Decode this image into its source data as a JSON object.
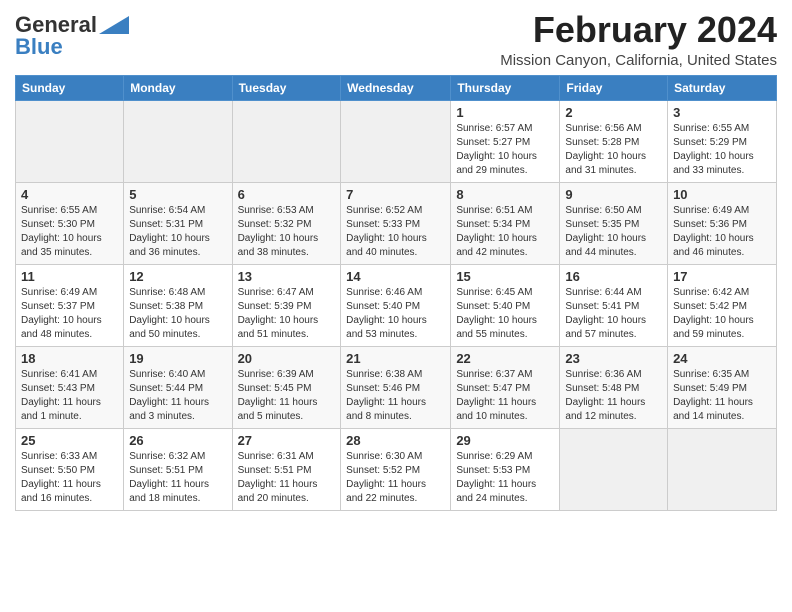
{
  "header": {
    "logo_general": "General",
    "logo_blue": "Blue",
    "month_year": "February 2024",
    "location": "Mission Canyon, California, United States"
  },
  "days_of_week": [
    "Sunday",
    "Monday",
    "Tuesday",
    "Wednesday",
    "Thursday",
    "Friday",
    "Saturday"
  ],
  "weeks": [
    [
      {
        "date": "",
        "info": "",
        "empty": true
      },
      {
        "date": "",
        "info": "",
        "empty": true
      },
      {
        "date": "",
        "info": "",
        "empty": true
      },
      {
        "date": "",
        "info": "",
        "empty": true
      },
      {
        "date": "1",
        "info": "Sunrise: 6:57 AM\nSunset: 5:27 PM\nDaylight: 10 hours\nand 29 minutes.",
        "empty": false
      },
      {
        "date": "2",
        "info": "Sunrise: 6:56 AM\nSunset: 5:28 PM\nDaylight: 10 hours\nand 31 minutes.",
        "empty": false
      },
      {
        "date": "3",
        "info": "Sunrise: 6:55 AM\nSunset: 5:29 PM\nDaylight: 10 hours\nand 33 minutes.",
        "empty": false
      }
    ],
    [
      {
        "date": "4",
        "info": "Sunrise: 6:55 AM\nSunset: 5:30 PM\nDaylight: 10 hours\nand 35 minutes.",
        "empty": false
      },
      {
        "date": "5",
        "info": "Sunrise: 6:54 AM\nSunset: 5:31 PM\nDaylight: 10 hours\nand 36 minutes.",
        "empty": false
      },
      {
        "date": "6",
        "info": "Sunrise: 6:53 AM\nSunset: 5:32 PM\nDaylight: 10 hours\nand 38 minutes.",
        "empty": false
      },
      {
        "date": "7",
        "info": "Sunrise: 6:52 AM\nSunset: 5:33 PM\nDaylight: 10 hours\nand 40 minutes.",
        "empty": false
      },
      {
        "date": "8",
        "info": "Sunrise: 6:51 AM\nSunset: 5:34 PM\nDaylight: 10 hours\nand 42 minutes.",
        "empty": false
      },
      {
        "date": "9",
        "info": "Sunrise: 6:50 AM\nSunset: 5:35 PM\nDaylight: 10 hours\nand 44 minutes.",
        "empty": false
      },
      {
        "date": "10",
        "info": "Sunrise: 6:49 AM\nSunset: 5:36 PM\nDaylight: 10 hours\nand 46 minutes.",
        "empty": false
      }
    ],
    [
      {
        "date": "11",
        "info": "Sunrise: 6:49 AM\nSunset: 5:37 PM\nDaylight: 10 hours\nand 48 minutes.",
        "empty": false
      },
      {
        "date": "12",
        "info": "Sunrise: 6:48 AM\nSunset: 5:38 PM\nDaylight: 10 hours\nand 50 minutes.",
        "empty": false
      },
      {
        "date": "13",
        "info": "Sunrise: 6:47 AM\nSunset: 5:39 PM\nDaylight: 10 hours\nand 51 minutes.",
        "empty": false
      },
      {
        "date": "14",
        "info": "Sunrise: 6:46 AM\nSunset: 5:40 PM\nDaylight: 10 hours\nand 53 minutes.",
        "empty": false
      },
      {
        "date": "15",
        "info": "Sunrise: 6:45 AM\nSunset: 5:40 PM\nDaylight: 10 hours\nand 55 minutes.",
        "empty": false
      },
      {
        "date": "16",
        "info": "Sunrise: 6:44 AM\nSunset: 5:41 PM\nDaylight: 10 hours\nand 57 minutes.",
        "empty": false
      },
      {
        "date": "17",
        "info": "Sunrise: 6:42 AM\nSunset: 5:42 PM\nDaylight: 10 hours\nand 59 minutes.",
        "empty": false
      }
    ],
    [
      {
        "date": "18",
        "info": "Sunrise: 6:41 AM\nSunset: 5:43 PM\nDaylight: 11 hours\nand 1 minute.",
        "empty": false
      },
      {
        "date": "19",
        "info": "Sunrise: 6:40 AM\nSunset: 5:44 PM\nDaylight: 11 hours\nand 3 minutes.",
        "empty": false
      },
      {
        "date": "20",
        "info": "Sunrise: 6:39 AM\nSunset: 5:45 PM\nDaylight: 11 hours\nand 5 minutes.",
        "empty": false
      },
      {
        "date": "21",
        "info": "Sunrise: 6:38 AM\nSunset: 5:46 PM\nDaylight: 11 hours\nand 8 minutes.",
        "empty": false
      },
      {
        "date": "22",
        "info": "Sunrise: 6:37 AM\nSunset: 5:47 PM\nDaylight: 11 hours\nand 10 minutes.",
        "empty": false
      },
      {
        "date": "23",
        "info": "Sunrise: 6:36 AM\nSunset: 5:48 PM\nDaylight: 11 hours\nand 12 minutes.",
        "empty": false
      },
      {
        "date": "24",
        "info": "Sunrise: 6:35 AM\nSunset: 5:49 PM\nDaylight: 11 hours\nand 14 minutes.",
        "empty": false
      }
    ],
    [
      {
        "date": "25",
        "info": "Sunrise: 6:33 AM\nSunset: 5:50 PM\nDaylight: 11 hours\nand 16 minutes.",
        "empty": false
      },
      {
        "date": "26",
        "info": "Sunrise: 6:32 AM\nSunset: 5:51 PM\nDaylight: 11 hours\nand 18 minutes.",
        "empty": false
      },
      {
        "date": "27",
        "info": "Sunrise: 6:31 AM\nSunset: 5:51 PM\nDaylight: 11 hours\nand 20 minutes.",
        "empty": false
      },
      {
        "date": "28",
        "info": "Sunrise: 6:30 AM\nSunset: 5:52 PM\nDaylight: 11 hours\nand 22 minutes.",
        "empty": false
      },
      {
        "date": "29",
        "info": "Sunrise: 6:29 AM\nSunset: 5:53 PM\nDaylight: 11 hours\nand 24 minutes.",
        "empty": false
      },
      {
        "date": "",
        "info": "",
        "empty": true
      },
      {
        "date": "",
        "info": "",
        "empty": true
      }
    ]
  ]
}
